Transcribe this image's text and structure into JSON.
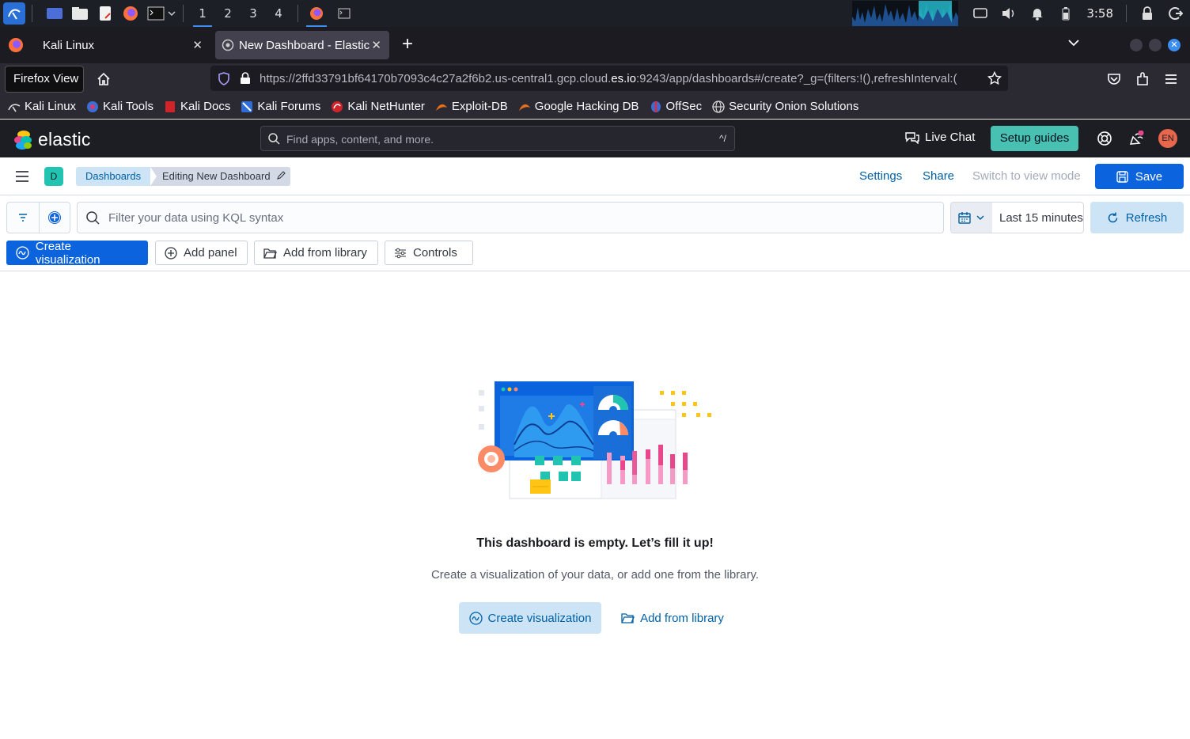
{
  "os": {
    "workspaces": [
      "1",
      "2",
      "3",
      "4"
    ],
    "clock": "3:58"
  },
  "browser": {
    "tabs": [
      {
        "title": "Kali Linux"
      },
      {
        "title": "New Dashboard - Elastic"
      }
    ],
    "tooltip": "Firefox View",
    "url_prefix": "https://2ffd33791bf64170b7093c4c27a2f6b2.us-central1.gcp.cloud.",
    "url_domain": "es.io",
    "url_suffix": ":9243/app/dashboards#/create?_g=(filters:!(),refreshInterval:(",
    "bookmarks": [
      "Kali Linux",
      "Kali Tools",
      "Kali Docs",
      "Kali Forums",
      "Kali NetHunter",
      "Exploit-DB",
      "Google Hacking DB",
      "OffSec",
      "Security Onion Solutions"
    ]
  },
  "header": {
    "logo_text": "elastic",
    "search_placeholder": "Find apps, content, and more.",
    "search_shortcut": "^/",
    "live_chat": "Live Chat",
    "setup_guides": "Setup guides",
    "avatar_initials": "EN",
    "space_initial": "D"
  },
  "breadcrumbs": {
    "root": "Dashboards",
    "current": "Editing New Dashboard"
  },
  "top_nav": {
    "settings": "Settings",
    "share": "Share",
    "switch_view": "Switch to view mode",
    "save": "Save"
  },
  "query": {
    "placeholder": "Filter your data using KQL syntax",
    "time_range": "Last 15 minutes",
    "refresh": "Refresh"
  },
  "panel_toolbar": {
    "create_visualization": "Create visualization",
    "add_panel": "Add panel",
    "add_from_library": "Add from library",
    "controls": "Controls"
  },
  "empty_state": {
    "title": "This dashboard is empty. Let’s fill it up!",
    "description": "Create a visualization of your data, or add one from the library.",
    "primary_action": "Create visualization",
    "secondary_action": "Add from library"
  },
  "colors": {
    "primary": "#0b64dd",
    "link": "#0061a6",
    "accent_teal": "#48c1b3",
    "header_bg": "#1d1e24"
  }
}
